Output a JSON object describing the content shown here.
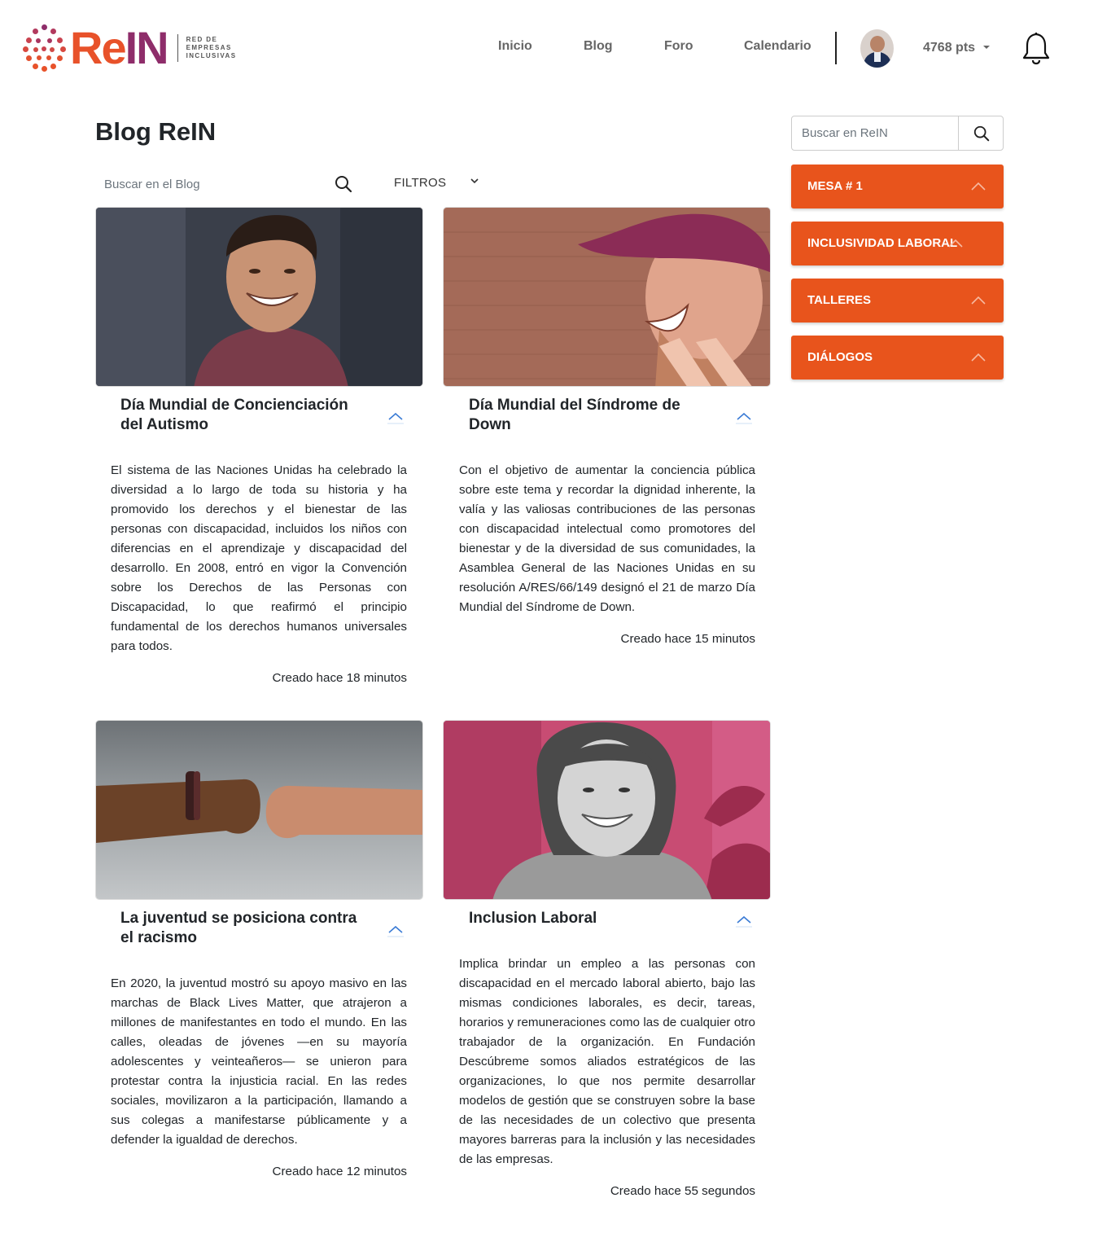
{
  "header": {
    "logo": {
      "word_re": "Re",
      "word_in": "IN",
      "sub_line1": "RED DE",
      "sub_line2": "EMPRESAS",
      "sub_line3": "INCLUSIVAS"
    },
    "nav": [
      {
        "label": "Inicio"
      },
      {
        "label": "Blog"
      },
      {
        "label": "Foro"
      },
      {
        "label": "Calendario"
      }
    ],
    "points": "4768 pts",
    "icons": {
      "avatar": "user-avatar",
      "caret": "caret-down-icon",
      "bell": "bell-icon"
    }
  },
  "main": {
    "title": "Blog ReIN",
    "search_placeholder": "Buscar en el Blog",
    "filters_label": "FILTROS",
    "cards": [
      {
        "title": "Día Mundial de Concienciación del Autismo",
        "text": "El sistema de las Naciones Unidas ha celebrado la diversidad a lo largo de toda su historia y ha promovido los derechos y el bienestar de las personas con discapacidad, incluidos los niños con diferencias en el aprendizaje y discapacidad del desarrollo. En 2008, entró en vigor la Convención sobre los Derechos de las Personas con Discapacidad, lo que reafirmó el principio fundamental de los derechos humanos universales para todos.",
        "time": "Creado hace 18 minutos"
      },
      {
        "title": "Día Mundial del Síndrome de Down",
        "text": "Con el objetivo de aumentar la conciencia pública sobre este tema y recordar la dignidad inherente, la valía y las valiosas contribuciones de las personas con discapacidad intelectual como promotores del bienestar y de la diversidad de sus comunidades, la Asamblea General de las Naciones Unidas en su resolución A/RES/66/149 designó el 21 de marzo Día Mundial del Síndrome de Down.",
        "time": "Creado hace 15 minutos"
      },
      {
        "title": "La juventud se posiciona contra el racismo",
        "text": "En 2020, la juventud mostró su apoyo masivo en las marchas de Black Lives Matter, que atrajeron a millones de manifestantes en todo el mundo. En las calles, oleadas de jóvenes —en su mayoría adolescentes y veinteañeros— se unieron para protestar contra la injusticia racial. En las redes sociales, movilizaron a la participación, llamando a sus colegas a manifestarse públicamente y a defender la igualdad de derechos.",
        "time": "Creado hace 12 minutos"
      },
      {
        "title": "Inclusion Laboral",
        "text": "Implica brindar un empleo a las personas con discapacidad en el mercado laboral abierto, bajo las mismas condiciones laborales, es decir, tareas, horarios y remuneraciones como las de cualquier otro trabajador de la organización. En Fundación Descúbreme somos aliados estratégicos de las organizaciones, lo que nos permite desarrollar modelos de gestión que se construyen sobre la base de las necesidades de un colectivo que presenta mayores barreras para la inclusión y las necesidades de las empresas.",
        "time": "Creado hace 55 segundos"
      }
    ]
  },
  "sidebar": {
    "search_placeholder": "Buscar en ReIN",
    "buttons": [
      {
        "label": "MESA # 1"
      },
      {
        "label": "INCLUSIVIDAD LABORAL"
      },
      {
        "label": "TALLERES"
      },
      {
        "label": "DIÁLOGOS"
      }
    ]
  },
  "colors": {
    "accent": "#e8541c",
    "brand_orange": "#e8522a",
    "brand_purple": "#8e2d6a",
    "link_blue": "#3a7bd5"
  }
}
